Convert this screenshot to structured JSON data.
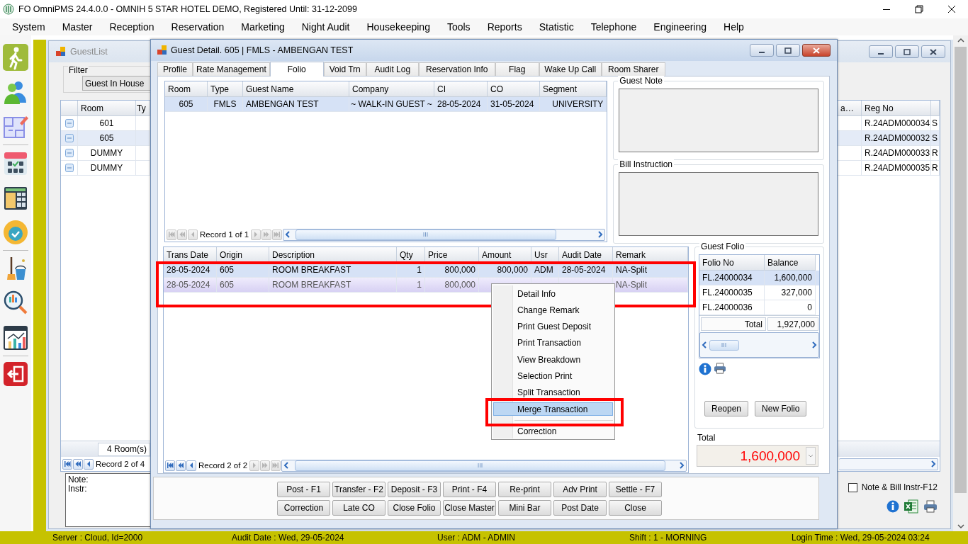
{
  "window": {
    "title": "FO OmniPMS 24.4.0.0 - OMNIH 5 STAR HOTEL DEMO, Registered Until: 31-12-2099"
  },
  "menu": [
    "System",
    "Master",
    "Reception",
    "Reservation",
    "Marketing",
    "Night Audit",
    "Housekeeping",
    "Tools",
    "Reports",
    "Statistic",
    "Telephone",
    "Engineering",
    "Help"
  ],
  "guest_list": {
    "title": "GuestList",
    "filter_label": "Filter",
    "filter_value": "Guest In House",
    "columns": [
      "Room",
      "Ty",
      "a…",
      "Reg No"
    ],
    "rows": [
      {
        "room": "601",
        "reg_no": "R.24ADM000034",
        "column_5": "S",
        "selected": false
      },
      {
        "room": "605",
        "reg_no": "R.24ADM000032",
        "column_5": "S",
        "selected": true
      },
      {
        "room": "DUMMY",
        "reg_no": "R.24ADM000033",
        "column_5": "R",
        "selected": false
      },
      {
        "room": "DUMMY",
        "reg_no": "R.24ADM000035",
        "column_5": "R",
        "selected": false
      }
    ],
    "room_count": "4 Room(s)",
    "navigator": {
      "record": "Record 2 of 4",
      "back_disabled": false
    },
    "note_label": "Note:",
    "instr_label": "Instr:",
    "note_bill_checkbox": {
      "label": "Note & Bill Instr-F12",
      "checked": false
    }
  },
  "guest_detail": {
    "title": "Guest Detail. 605 | FMLS - AMBENGAN TEST",
    "tabs": [
      {
        "label": "Profile",
        "selected": false
      },
      {
        "label": "Rate Management",
        "selected": false
      },
      {
        "label": "Folio",
        "selected": true
      },
      {
        "label": "Void Trn",
        "selected": false
      },
      {
        "label": "Audit Log",
        "selected": false
      },
      {
        "label": "Reservation Info",
        "selected": false
      },
      {
        "label": "Flag",
        "selected": false
      },
      {
        "label": "Wake Up Call",
        "selected": false
      },
      {
        "label": "Room Sharer",
        "selected": false
      }
    ],
    "guests": {
      "columns": [
        "Room",
        "Type",
        "Guest Name",
        "Company",
        "CI",
        "CO",
        "Segment"
      ],
      "rows": [
        {
          "room": "605",
          "type": "FMLS",
          "guest_name": "AMBENGAN TEST",
          "company": "~ WALK-IN GUEST ~",
          "ci": "28-05-2024",
          "co": "31-05-2024",
          "segment": "UNIVERSITY",
          "selected": true
        }
      ],
      "navigator": {
        "record": "Record 1 of 1",
        "back_disabled": true,
        "forward_disabled": true
      }
    },
    "guest_note": {
      "label": "Guest Note"
    },
    "bill_instruction": {
      "label": "Bill Instruction"
    },
    "transactions": {
      "columns": [
        "Trans Date",
        "Origin",
        "Description",
        "Qty",
        "Price",
        "Amount",
        "Usr",
        "Audit Date",
        "Remark"
      ],
      "rows": [
        {
          "trans_date": "28-05-2024",
          "origin": "605",
          "description": "ROOM BREAKFAST",
          "qty": "1",
          "price": "800,000",
          "amount": "800,000",
          "usr": "ADM",
          "audit_date": "28-05-2024",
          "remark": "NA-Split",
          "selected": true,
          "focused": false
        },
        {
          "trans_date": "28-05-2024",
          "origin": "605",
          "description": "ROOM BREAKFAST",
          "qty": "1",
          "price": "800,000",
          "remark": "NA-Split",
          "selected": true,
          "focused": true
        }
      ],
      "navigator": {
        "record": "Record 2 of 2",
        "back_disabled": false,
        "forward_disabled": true
      }
    },
    "guest_folio": {
      "label": "Guest Folio",
      "columns": [
        "Folio No",
        "Balance"
      ],
      "rows": [
        {
          "folio_no": "FL.24000034",
          "balance": "1,600,000",
          "selected": true
        },
        {
          "folio_no": "FL.24000035",
          "balance": "327,000",
          "selected": false
        },
        {
          "folio_no": "FL.24000036",
          "balance": "0",
          "selected": false
        }
      ],
      "total_label": "Total",
      "total": "1,927,000",
      "buttons": [
        "Reopen",
        "New Folio"
      ]
    },
    "total": {
      "label": "Total",
      "value": "1,600,000"
    },
    "buttons": [
      [
        "Post - F1",
        "Transfer - F2",
        "Deposit - F3",
        "Print - F4",
        "Re-print",
        "Adv Print",
        "Settle - F7"
      ],
      [
        "Correction",
        "Late CO",
        "Close Folio",
        "Close Master",
        "Mini Bar",
        "Post Date",
        "Close"
      ]
    ]
  },
  "context_menu": [
    {
      "kind": "item",
      "label": "Detail Info",
      "selected": false
    },
    {
      "kind": "item",
      "label": "Change Remark",
      "selected": false
    },
    {
      "kind": "item",
      "label": "Print Guest Deposit",
      "selected": false
    },
    {
      "kind": "item",
      "label": "Print Transaction",
      "selected": false
    },
    {
      "kind": "item",
      "label": "View Breakdown",
      "selected": false
    },
    {
      "kind": "item",
      "label": "Selection Print",
      "selected": false
    },
    {
      "kind": "item",
      "label": "Split Transaction",
      "selected": false
    },
    {
      "kind": "item",
      "label": "Merge Transaction",
      "selected": true
    },
    {
      "kind": "separator"
    },
    {
      "kind": "item",
      "label": "Correction",
      "selected": false
    }
  ],
  "status_bar": [
    "Server : Cloud, Id=2000",
    "Audit Date : Wed, 29-05-2024",
    "User : ADM - ADMIN",
    "Shift : 1 - MORNING",
    "Login Time : Wed, 29-05-2024 03:24"
  ]
}
